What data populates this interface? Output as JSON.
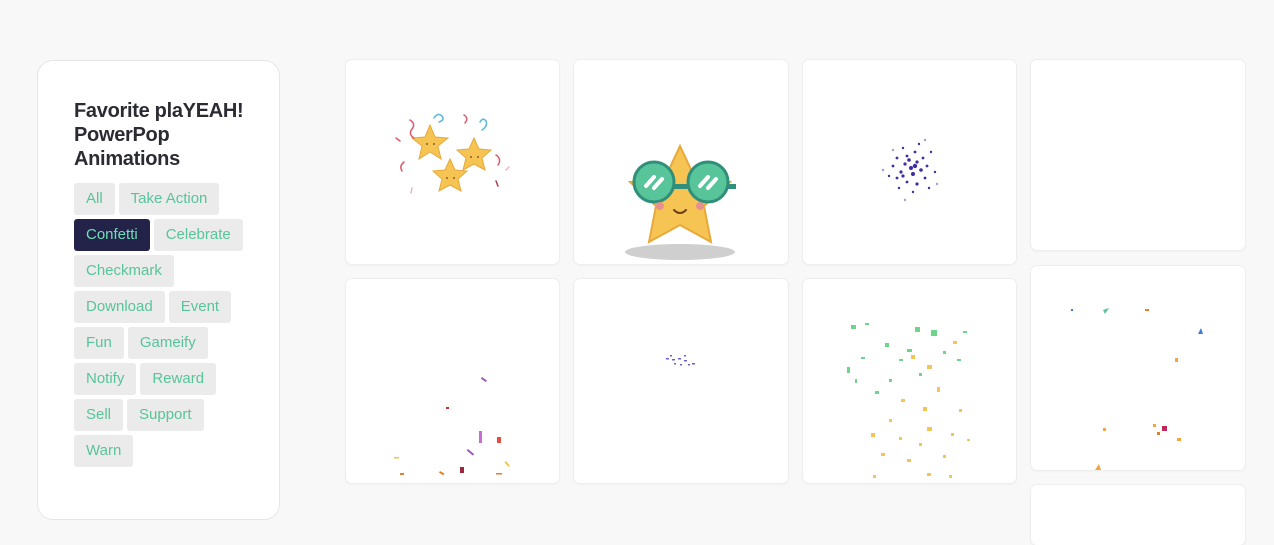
{
  "panel": {
    "title_lines": [
      "Favorite plaYEAH!",
      "PowerPop",
      "Animations"
    ]
  },
  "filters": [
    {
      "label": "All",
      "active": false
    },
    {
      "label": "Take Action",
      "active": false
    },
    {
      "label": "Confetti",
      "active": true
    },
    {
      "label": "Celebrate",
      "active": false
    },
    {
      "label": "Checkmark",
      "active": false
    },
    {
      "label": "Download",
      "active": false
    },
    {
      "label": "Event",
      "active": false
    },
    {
      "label": "Fun",
      "active": false
    },
    {
      "label": "Gameify",
      "active": false
    },
    {
      "label": "Notify",
      "active": false
    },
    {
      "label": "Reward",
      "active": false
    },
    {
      "label": "Sell",
      "active": false
    },
    {
      "label": "Support",
      "active": false
    },
    {
      "label": "Warn",
      "active": false
    }
  ],
  "animations": [
    {
      "name": "stars-confetti",
      "icon": "three-stars-icon"
    },
    {
      "name": "star-sunglasses",
      "icon": "star-sunglasses-icon"
    },
    {
      "name": "purple-burst",
      "icon": "particle-burst-icon"
    },
    {
      "name": "blank-1",
      "icon": "empty-animation-icon"
    },
    {
      "name": "falling-confetti",
      "icon": "confetti-icon"
    },
    {
      "name": "small-burst",
      "icon": "particle-burst-icon"
    },
    {
      "name": "green-yellow-confetti",
      "icon": "confetti-icon"
    },
    {
      "name": "sparse-confetti",
      "icon": "confetti-icon"
    }
  ],
  "colors": {
    "accent_text": "#58c49a",
    "active_bg": "#23234a",
    "chip_bg": "#ebebeb",
    "star_yellow": "#f5c453",
    "glasses_green": "#58c49a",
    "burst_purple": "#3d2fa3"
  }
}
